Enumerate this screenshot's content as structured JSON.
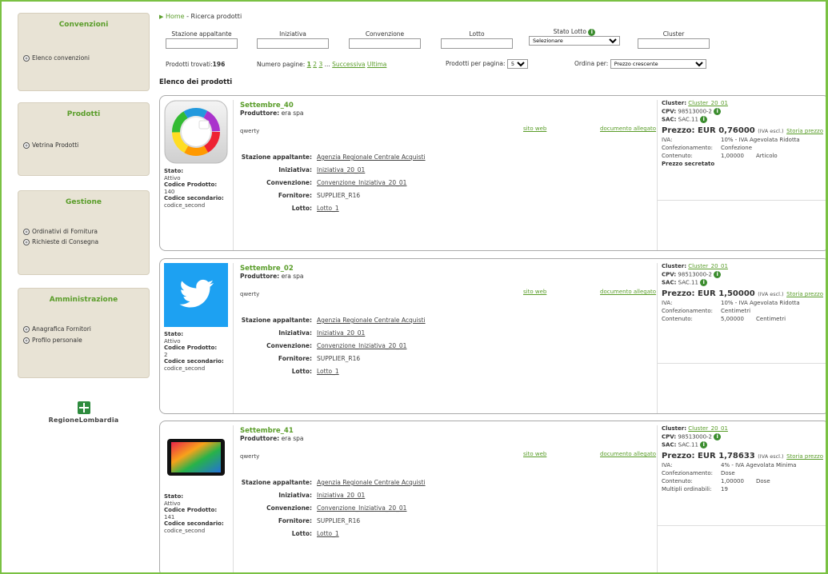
{
  "colors": {
    "accent": "#5a9d2a",
    "frame": "#7ac143",
    "sidebar_bg": "#e8e3d5",
    "info": "#3c8d2f"
  },
  "sidebar": {
    "sections": [
      {
        "title": "Convenzioni",
        "items": [
          "Elenco convenzioni"
        ]
      },
      {
        "title": "Prodotti",
        "items": [
          "Vetrina Prodotti"
        ]
      },
      {
        "title": "Gestione",
        "items": [
          "Ordinativi di Fornitura",
          "Richieste di Consegna"
        ]
      },
      {
        "title": "Amministrazione",
        "items": [
          "Anagrafica Fornitori",
          "Profilo personale"
        ]
      }
    ],
    "logo_text": "RegioneLombardia"
  },
  "breadcrumb": {
    "home": "Home",
    "sep": " - ",
    "current": "Ricerca prodotti"
  },
  "filters": {
    "stazione": "Stazione appaltante",
    "iniziativa": "Iniziativa",
    "convenzione": "Convenzione",
    "lotto": "Lotto",
    "stato_lotto": "Stato Lotto",
    "stato_lotto_selected": "Selezionare",
    "cluster": "Cluster"
  },
  "topbar": {
    "found_label": "Prodotti trovati:",
    "found_count": "196",
    "pages_label": "Numero pagine:",
    "page1": "1",
    "page2": "2",
    "page3": "3",
    "ellipsis": "...",
    "next": "Successiva",
    "last": "Ultima",
    "per_page_label": "Prodotti per pagina:",
    "per_page_value": "5",
    "sort_label": "Ordina per:",
    "sort_value": "Prezzo crescente"
  },
  "list_title": "Elenco dei prodotti",
  "labels": {
    "stato": "Stato:",
    "codice": "Codice Prodotto:",
    "codice_sec": "Codice secondario:",
    "produttore": "Produttore:",
    "sito_web": "sito web",
    "documento": "documento allegato",
    "stazione": "Stazione appaltante:",
    "iniziativa": "Iniziativa:",
    "convenzione": "Convenzione:",
    "fornitore": "Fornitore:",
    "lotto": "Lotto:",
    "cluster": "Cluster:",
    "cpv": "CPV:",
    "sac": "SAC:",
    "prezzo": "Prezzo:",
    "currency": "EUR",
    "iva_escl": "(IVA escl.)",
    "storia": "Storia prezzo",
    "iva": "IVA:",
    "confezionamento": "Confezionamento:",
    "contenuto": "Contenuto:",
    "multipli": "Multipli ordinabili:"
  },
  "products": [
    {
      "name": "Settembre_40",
      "producer": "era spa",
      "desc": "qwerty",
      "stato": "Attivo",
      "codice": "140",
      "codice_sec": "codice_second",
      "stazione": "Agenzia Regionale Centrale Acquisti",
      "iniziativa": "Iniziativa_20_01",
      "convenzione": "Convenzione_Iniziativa_20_01",
      "fornitore": "SUPPLIER_R16",
      "lotto": "Lotto_1",
      "cluster": "Cluster_20_01",
      "cpv": "98513000-2",
      "sac": "SAC.11",
      "price": "0,76000",
      "iva": "10% - IVA Agevolata Ridotta",
      "confezionamento": "Confezione",
      "contenuto_q": "1,00000",
      "contenuto_u": "Articolo",
      "extra": "Prezzo secretato",
      "image": "color-wheel-icon"
    },
    {
      "name": "Settembre_02",
      "producer": "era spa",
      "desc": "qwerty",
      "stato": "Attivo",
      "codice": "2",
      "codice_sec": "codice_second",
      "stazione": "Agenzia Regionale Centrale Acquisti",
      "iniziativa": "Iniziativa_20_01",
      "convenzione": "Convenzione_Iniziativa_20_01",
      "fornitore": "SUPPLIER_R16",
      "lotto": "Lotto_1",
      "cluster": "Cluster_20_01",
      "cpv": "98513000-2",
      "sac": "SAC.11",
      "price": "1,50000",
      "iva": "10% - IVA Agevolata Ridotta",
      "confezionamento": "Centimetri",
      "contenuto_q": "5,00000",
      "contenuto_u": "Centimetri",
      "image": "twitter-bird-icon"
    },
    {
      "name": "Settembre_41",
      "producer": "era spa",
      "desc": "qwerty",
      "stato": "Attivo",
      "codice": "141",
      "codice_sec": "codice_second",
      "stazione": "Agenzia Regionale Centrale Acquisti",
      "iniziativa": "Iniziativa_20_01",
      "convenzione": "Convenzione_Iniziativa_20_01",
      "fornitore": "SUPPLIER_R16",
      "lotto": "Lotto_1",
      "cluster": "Cluster_20_01",
      "cpv": "98513000-2",
      "sac": "SAC.11",
      "price": "1,78633",
      "iva": "4% - IVA Agevolata Minima",
      "confezionamento": "Dose",
      "contenuto_q": "1,00000",
      "contenuto_u": "Dose",
      "multipli": "19",
      "image": "tablet-icon"
    }
  ]
}
